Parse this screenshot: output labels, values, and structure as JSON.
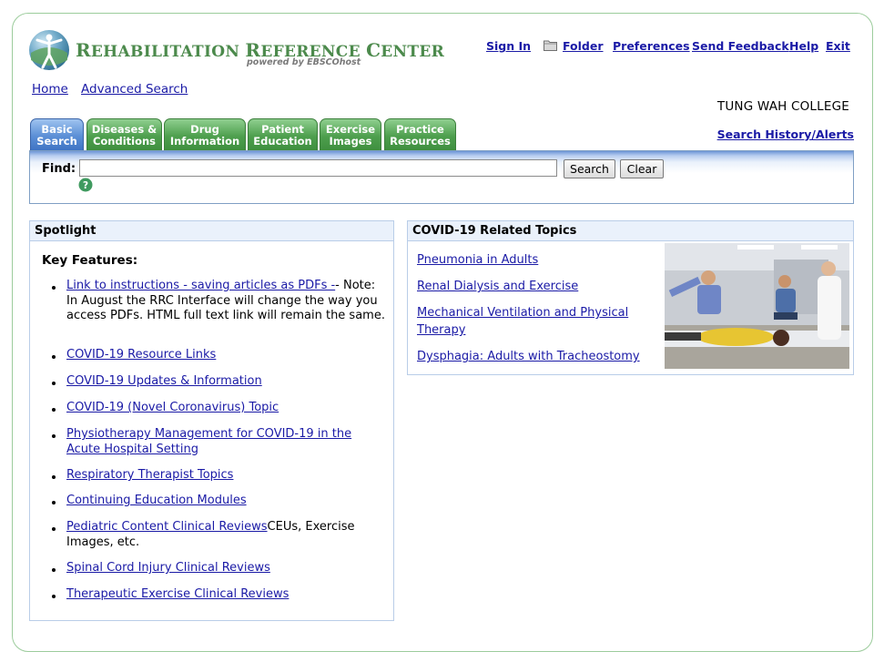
{
  "header": {
    "logo_title_parts": [
      "R",
      "EHABILITATION ",
      "R",
      "EFERENCE ",
      "C",
      "ENTER"
    ],
    "logo_powered": "powered by EBSCOhost",
    "nav": {
      "sign_in": "Sign In",
      "folder": "Folder",
      "preferences": "Preferences",
      "send_feedback": "Send Feedback",
      "help": "Help",
      "exit": "Exit"
    }
  },
  "secondary_nav": {
    "home": "Home",
    "advanced_search": "Advanced Search"
  },
  "institution": "TUNG WAH COLLEGE",
  "search_history": "Search History/Alerts",
  "tabs": [
    {
      "line1": "Basic",
      "line2": "Search"
    },
    {
      "line1": "Diseases &",
      "line2": "Conditions"
    },
    {
      "line1": "Drug",
      "line2": "Information"
    },
    {
      "line1": "Patient",
      "line2": "Education"
    },
    {
      "line1": "Exercise",
      "line2": "Images"
    },
    {
      "line1": "Practice",
      "line2": "Resources"
    }
  ],
  "search": {
    "find_label": "Find:",
    "value": "",
    "search_button": "Search",
    "clear_button": "Clear"
  },
  "spotlight": {
    "title": "Spotlight",
    "key_features": "Key Features:",
    "items": [
      {
        "link": "Link to instructions - saving articles as PDFs -",
        "text": "- Note: In August the RRC Interface will change the way you access PDFs. HTML full text link will remain the same."
      },
      {
        "link": "COVID-19 Resource Links",
        "text": ""
      },
      {
        "link": "COVID-19 Updates & Information",
        "text": ""
      },
      {
        "link": "COVID-19 (Novel Coronavirus) Topic",
        "text": ""
      },
      {
        "link": "Physiotherapy Management for COVID-19 in the Acute Hospital Setting",
        "text": ""
      },
      {
        "link": "Respiratory Therapist Topics",
        "text": ""
      },
      {
        "link": "Continuing Education Modules",
        "text": ""
      },
      {
        "link": "Pediatric Content Clinical Reviews",
        "text": "CEUs, Exercise Images, etc."
      },
      {
        "link": "Spinal Cord Injury Clinical Reviews",
        "text": ""
      },
      {
        "link": "Therapeutic Exercise Clinical Reviews",
        "text": ""
      }
    ]
  },
  "covid": {
    "title": "COVID-19 Related Topics",
    "links": [
      "Pneumonia in Adults",
      "Renal Dialysis and Exercise",
      "Mechanical Ventilation and Physical Therapy",
      "Dysphagia: Adults with Tracheostomy"
    ]
  },
  "colors": {
    "link": "#1a1aa6",
    "tab_green": "#4e9f4e",
    "tab_blue": "#5b8fd6",
    "logo_green": "#4c8a4c"
  }
}
